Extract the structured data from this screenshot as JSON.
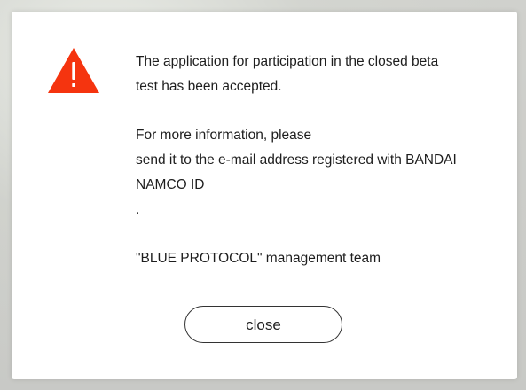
{
  "dialog": {
    "icon": "warning-triangle-icon",
    "accent_color": "#f5340f",
    "message": {
      "line1": "The application for participation in the closed beta",
      "line2": "test has been accepted.",
      "line3": "For more information, please",
      "line4": "send it to the e-mail address registered with BANDAI",
      "line5": "NAMCO ID",
      "line6": ".",
      "line7": "\"BLUE PROTOCOL\" management team"
    },
    "close_label": "close"
  }
}
